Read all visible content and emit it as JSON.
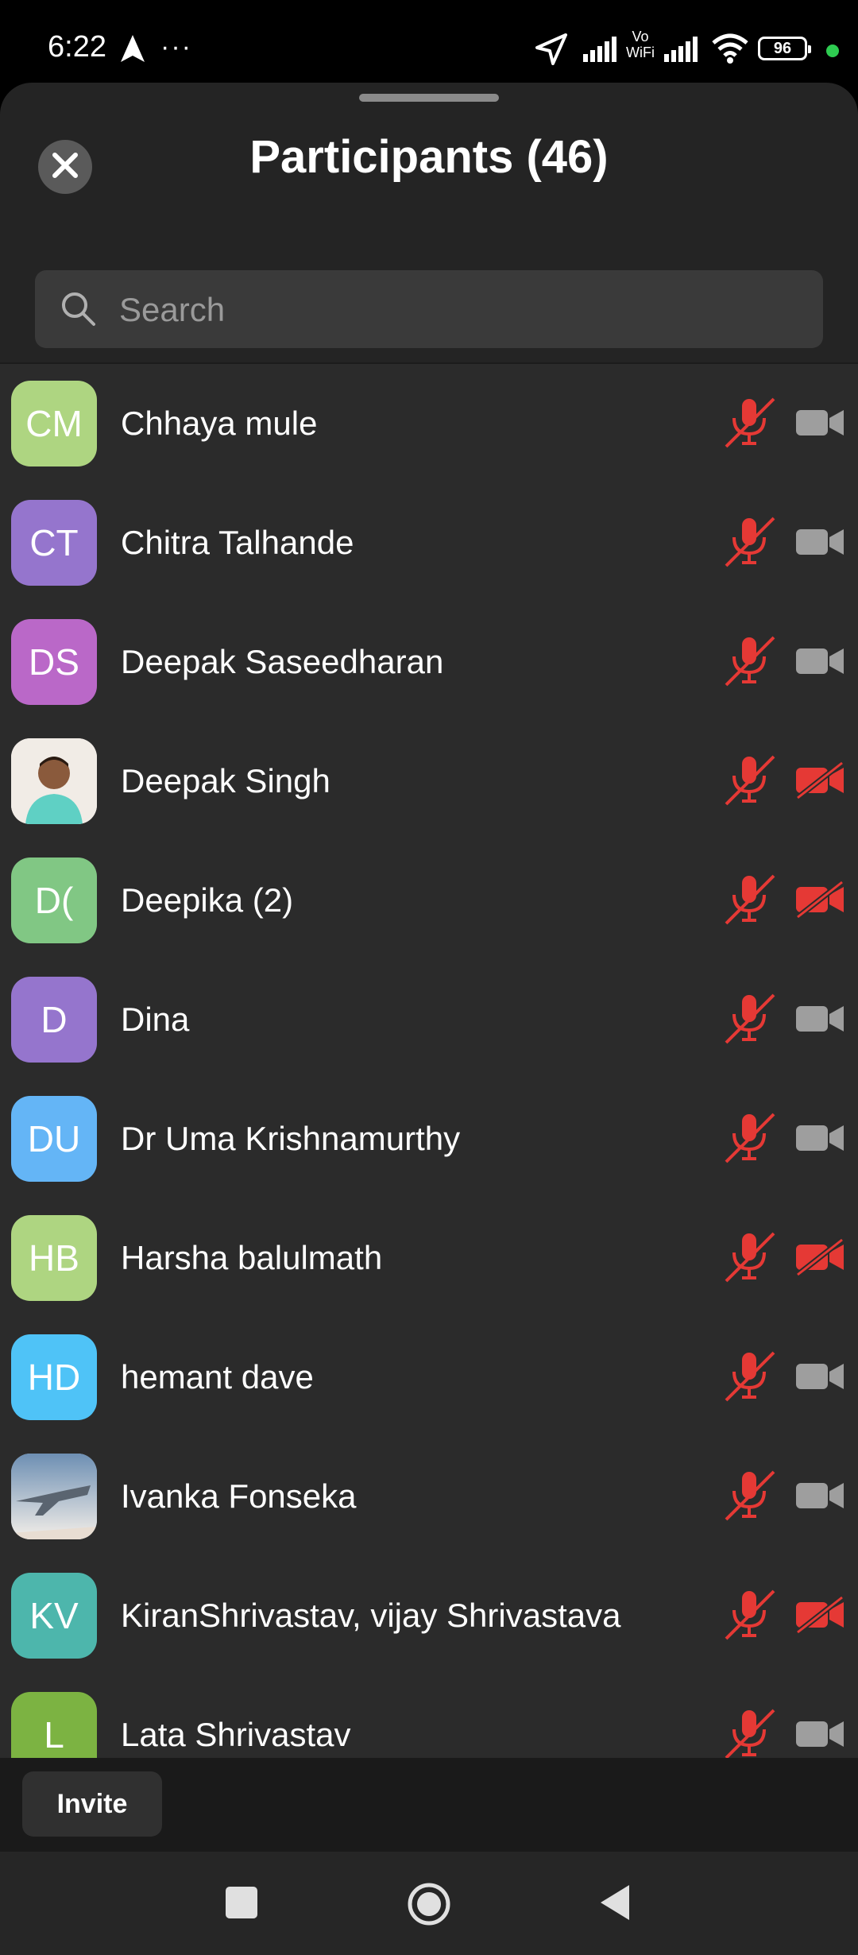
{
  "status_bar": {
    "time": "6:22",
    "more": "···",
    "vowifi": "Vo\nWiFi",
    "battery": "96",
    "dot_color": "#2ecc51"
  },
  "sheet": {
    "title": "Participants (46)",
    "search_placeholder": "Search"
  },
  "icons": {
    "mic_muted_color": "#e53935",
    "cam_off_color": "#e53935",
    "cam_on_color": "#9e9e9e"
  },
  "participants": [
    {
      "initials": "CM",
      "name": "Chhaya mule",
      "color": "#aed581",
      "photo": false,
      "video": "on"
    },
    {
      "initials": "CT",
      "name": "Chitra Talhande",
      "color": "#9575cd",
      "photo": false,
      "video": "on"
    },
    {
      "initials": "DS",
      "name": "Deepak Saseedharan",
      "color": "#ba68c8",
      "photo": false,
      "video": "on"
    },
    {
      "initials": "",
      "name": "Deepak Singh",
      "color": "#f1ece6",
      "photo": true,
      "video": "off"
    },
    {
      "initials": "D(",
      "name": "Deepika (2)",
      "color": "#81c784",
      "photo": false,
      "video": "off"
    },
    {
      "initials": "D",
      "name": "Dina",
      "color": "#9575cd",
      "photo": false,
      "video": "on"
    },
    {
      "initials": "DU",
      "name": "Dr Uma Krishnamurthy",
      "color": "#64b5f6",
      "photo": false,
      "video": "on"
    },
    {
      "initials": "HB",
      "name": "Harsha balulmath",
      "color": "#aed581",
      "photo": false,
      "video": "off"
    },
    {
      "initials": "HD",
      "name": "hemant dave",
      "color": "#4fc3f7",
      "photo": false,
      "video": "on"
    },
    {
      "initials": "",
      "name": "Ivanka Fonseka",
      "color": "#b9c8d8",
      "photo": true,
      "video": "on"
    },
    {
      "initials": "KV",
      "name": "KiranShrivastav, vijay Shrivastava",
      "color": "#4db6ac",
      "photo": false,
      "video": "off"
    },
    {
      "initials": "L",
      "name": "Lata Shrivastav",
      "color": "#7cb342",
      "photo": false,
      "video": "on"
    }
  ],
  "footer": {
    "invite_label": "Invite"
  }
}
